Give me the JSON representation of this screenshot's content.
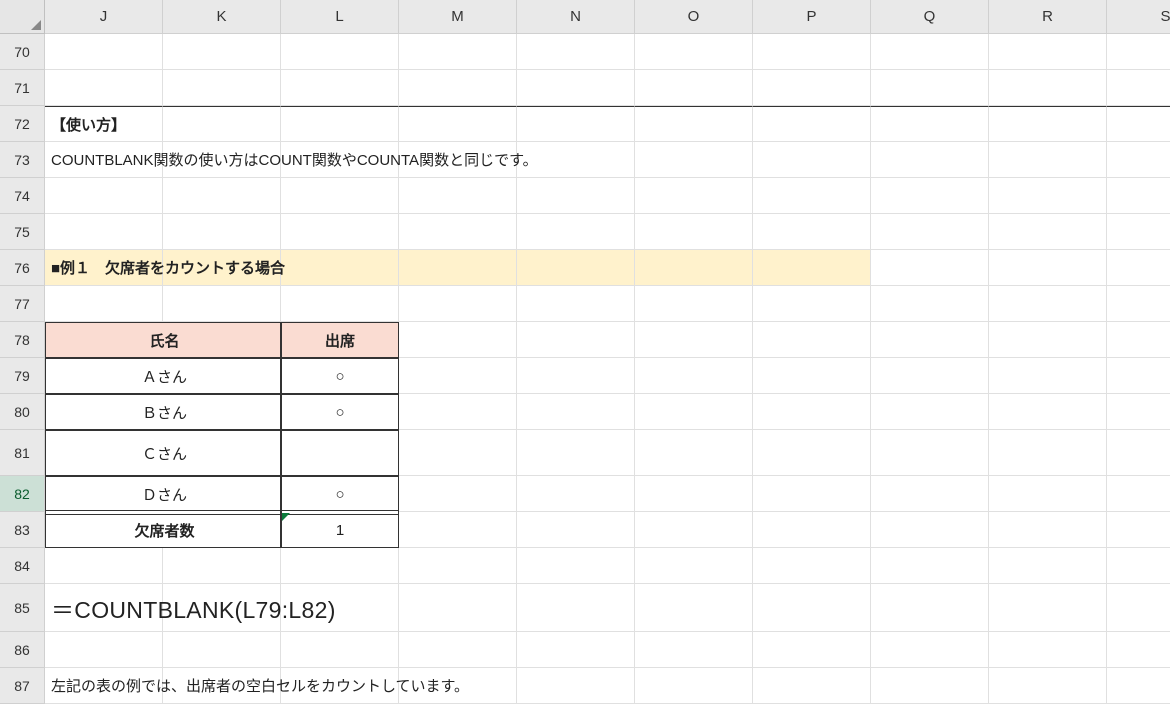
{
  "columns": [
    "J",
    "K",
    "L",
    "M",
    "N",
    "O",
    "P",
    "Q",
    "R",
    "S"
  ],
  "rows": [
    "70",
    "71",
    "72",
    "73",
    "74",
    "75",
    "76",
    "77",
    "78",
    "79",
    "80",
    "81",
    "82",
    "83",
    "84",
    "85",
    "86",
    "87"
  ],
  "row_heights": {
    "81": 46,
    "85": 48
  },
  "selected_row": "82",
  "content": {
    "J72": {
      "text": "【使い方】",
      "bold": true
    },
    "J73": {
      "text": "COUNTBLANK関数の使い方はCOUNT関数やCOUNTA関数と同じです。"
    },
    "J76": {
      "text": "■例１　欠席者をカウントする場合",
      "bold": true
    },
    "J85": {
      "text": "＝COUNTBLANK(L79:L82)",
      "formula": true
    },
    "J87": {
      "text": "左記の表の例では、出席者の空白セルをカウントしています。"
    }
  },
  "table": {
    "header": {
      "name": "氏名",
      "attend": "出席"
    },
    "rows": [
      {
        "name": "Ａさん",
        "attend": "○"
      },
      {
        "name": "Ｂさん",
        "attend": "○"
      },
      {
        "name": "Ｃさん",
        "attend": ""
      },
      {
        "name": "Ｄさん",
        "attend": "○"
      }
    ],
    "footer": {
      "label": "欠席者数",
      "value": "1"
    }
  },
  "highlight_cols_76": [
    "J",
    "K",
    "L",
    "M",
    "N",
    "O",
    "P"
  ],
  "chart_data": {
    "type": "table",
    "title": "欠席者カウント例",
    "columns": [
      "氏名",
      "出席"
    ],
    "rows": [
      [
        "Ａさん",
        "○"
      ],
      [
        "Ｂさん",
        "○"
      ],
      [
        "Ｃさん",
        ""
      ],
      [
        "Ｄさん",
        "○"
      ]
    ],
    "summary": {
      "欠席者数": 1
    },
    "formula": "=COUNTBLANK(L79:L82)"
  }
}
